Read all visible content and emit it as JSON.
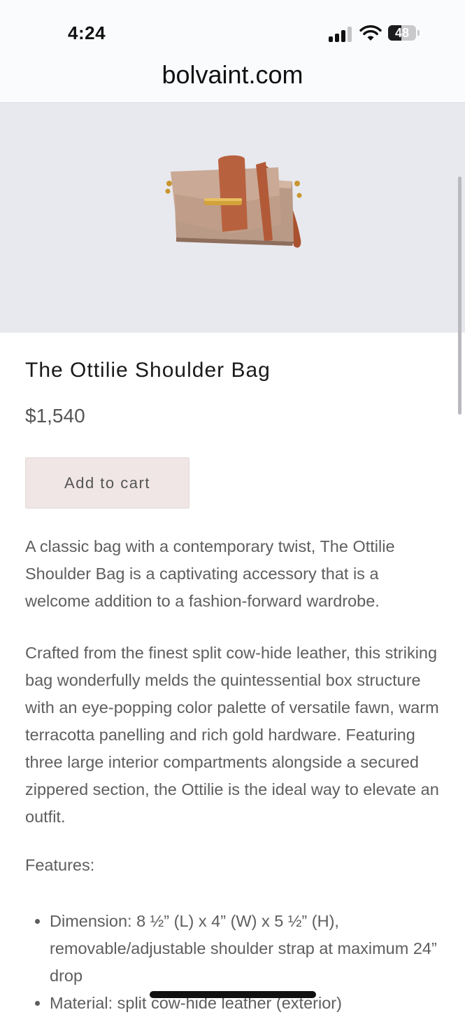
{
  "status_bar": {
    "time": "4:24",
    "battery_level": "48",
    "signal_bars": 3,
    "signal_bars_total": 4,
    "battery_fraction": 0.48
  },
  "browser": {
    "url": "bolvaint.com"
  },
  "product": {
    "title": "The Ottilie Shoulder Bag",
    "price": "$1,540",
    "add_to_cart_label": "Add to cart",
    "description": [
      "A classic bag with a contemporary twist, The Ottilie Shoulder Bag is a captivating accessory that is a welcome addition to a fashion-forward wardrobe.",
      "Crafted from the finest split cow-hide leather, this striking bag wonderfully melds the quintessential box structure with an eye-popping color palette of versatile fawn, warm terracotta panelling and rich gold hardware. Featuring three large interior compartments alongside a secured zippered section, the Ottilie is the ideal way to elevate an outfit."
    ],
    "features_heading": "Features:",
    "features": [
      "Dimension: 8 ½” (L) x 4” (W) x 5 ½” (H), removable/adjustable shoulder strap at maximum 24” drop",
      "Material: split cow-hide leather (exterior)"
    ]
  },
  "colors": {
    "hero_background": "#e8e9ee",
    "cart_button": "#f0e6e6",
    "bag_fawn": "#c9a994",
    "bag_terracotta": "#b8613f",
    "bag_gold": "#c8962e"
  },
  "icons": {
    "signal": "cellular-signal-icon",
    "wifi": "wifi-icon",
    "battery": "battery-icon"
  }
}
